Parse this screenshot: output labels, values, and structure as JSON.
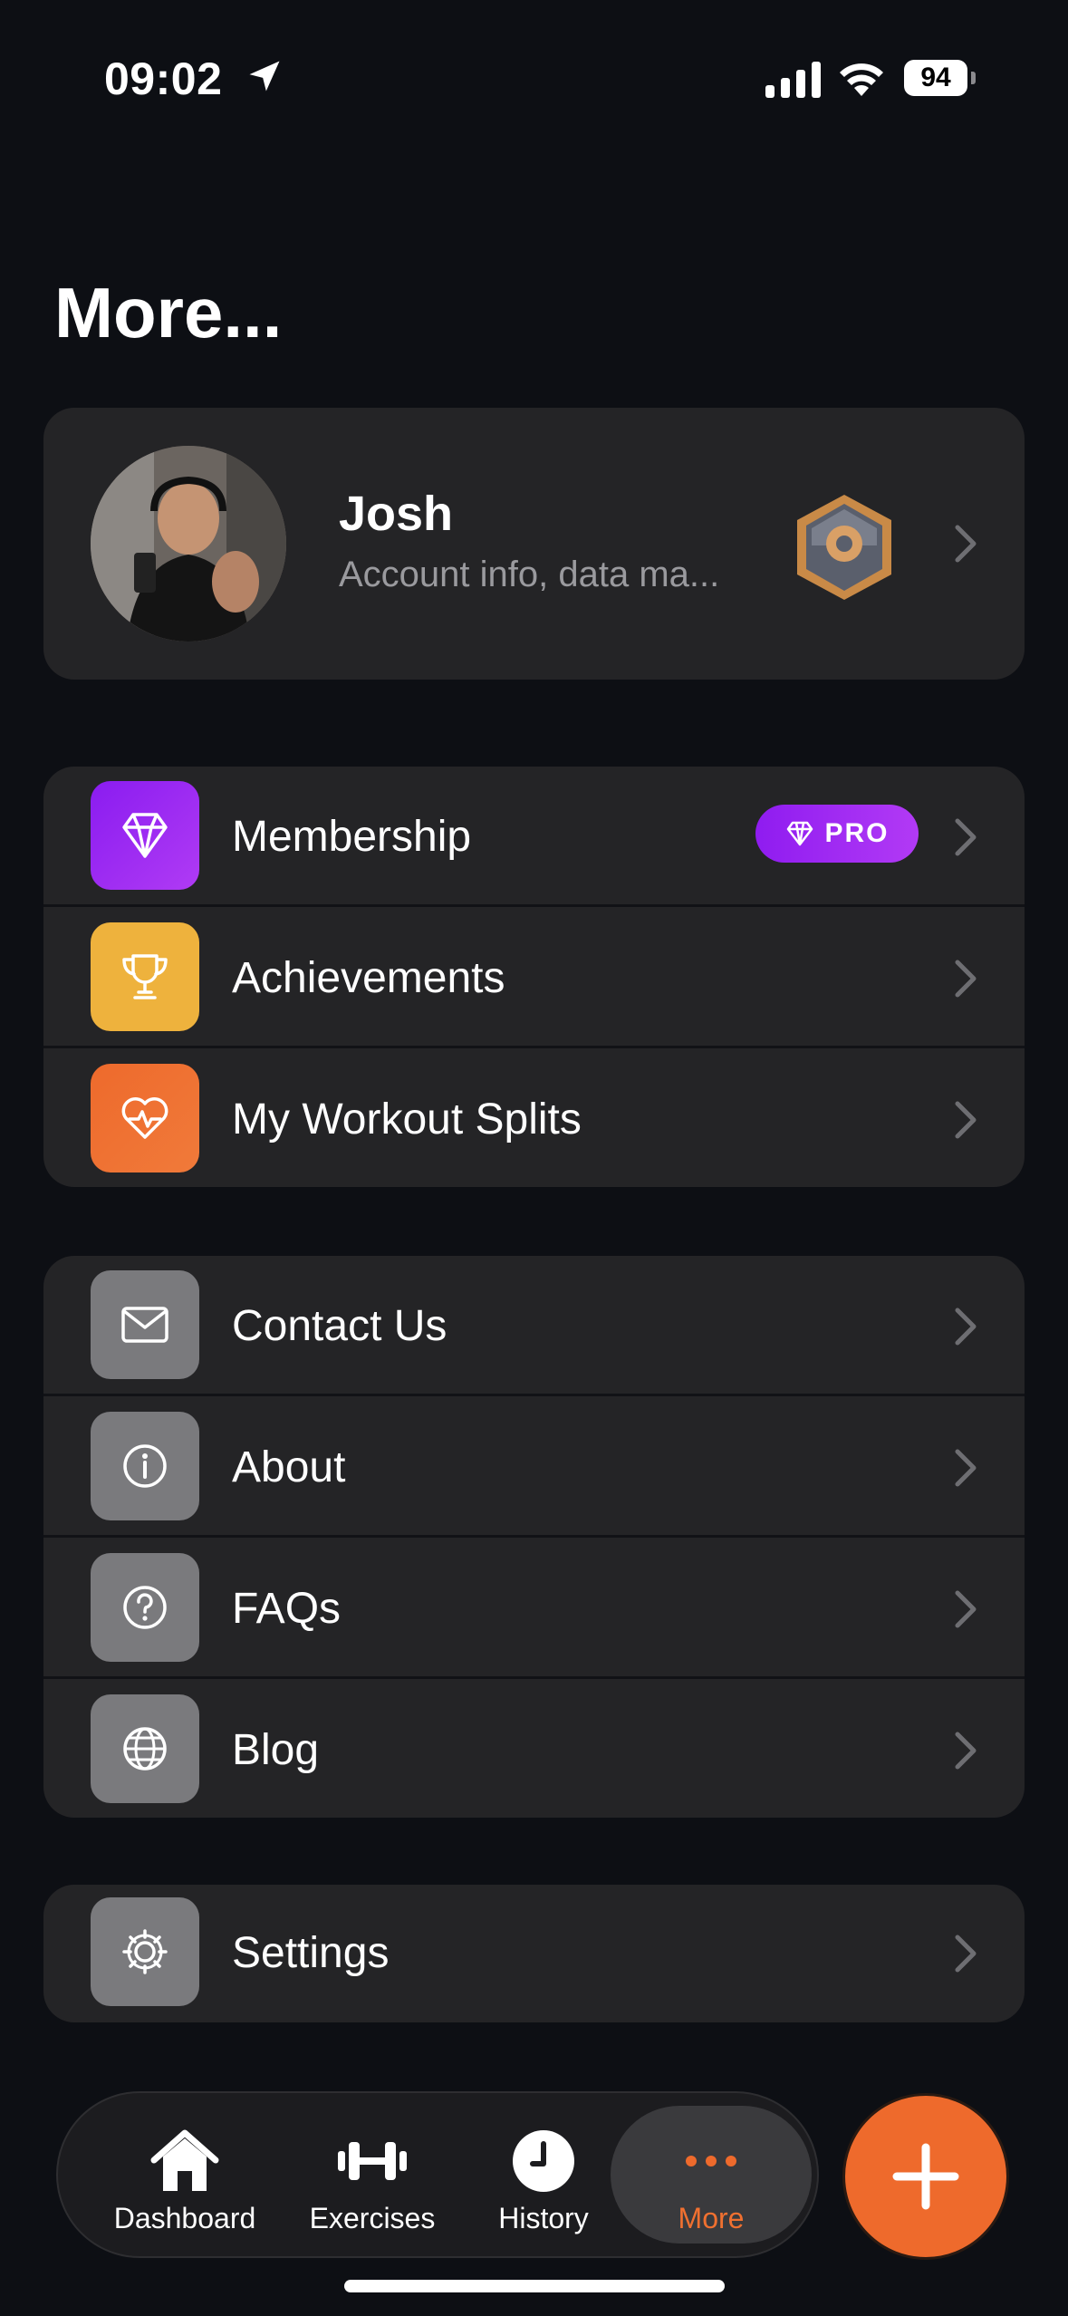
{
  "status_bar": {
    "time": "09:02",
    "battery": "94"
  },
  "page": {
    "title": "More..."
  },
  "profile": {
    "name": "Josh",
    "subtitle": "Account info, data ma..."
  },
  "group1": [
    {
      "label": "Membership",
      "icon": "diamond-icon",
      "color": "#8a1cf0",
      "badge": "PRO"
    },
    {
      "label": "Achievements",
      "icon": "trophy-icon",
      "color": "#eeb23d"
    },
    {
      "label": "My Workout Splits",
      "icon": "heart-pulse-icon",
      "color": "#ee6a2c"
    }
  ],
  "group2": [
    {
      "label": "Contact Us",
      "icon": "envelope-icon",
      "color": "#7a7a7d"
    },
    {
      "label": "About",
      "icon": "info-icon",
      "color": "#7a7a7d"
    },
    {
      "label": "FAQs",
      "icon": "question-icon",
      "color": "#7a7a7d"
    },
    {
      "label": "Blog",
      "icon": "globe-icon",
      "color": "#7a7a7d"
    }
  ],
  "group3": [
    {
      "label": "Settings",
      "icon": "gear-icon",
      "color": "#7a7a7d"
    }
  ],
  "tabbar": {
    "dashboard": "Dashboard",
    "exercises": "Exercises",
    "history": "History",
    "more": "More",
    "active": "More",
    "accent": "#ee6a2c"
  }
}
